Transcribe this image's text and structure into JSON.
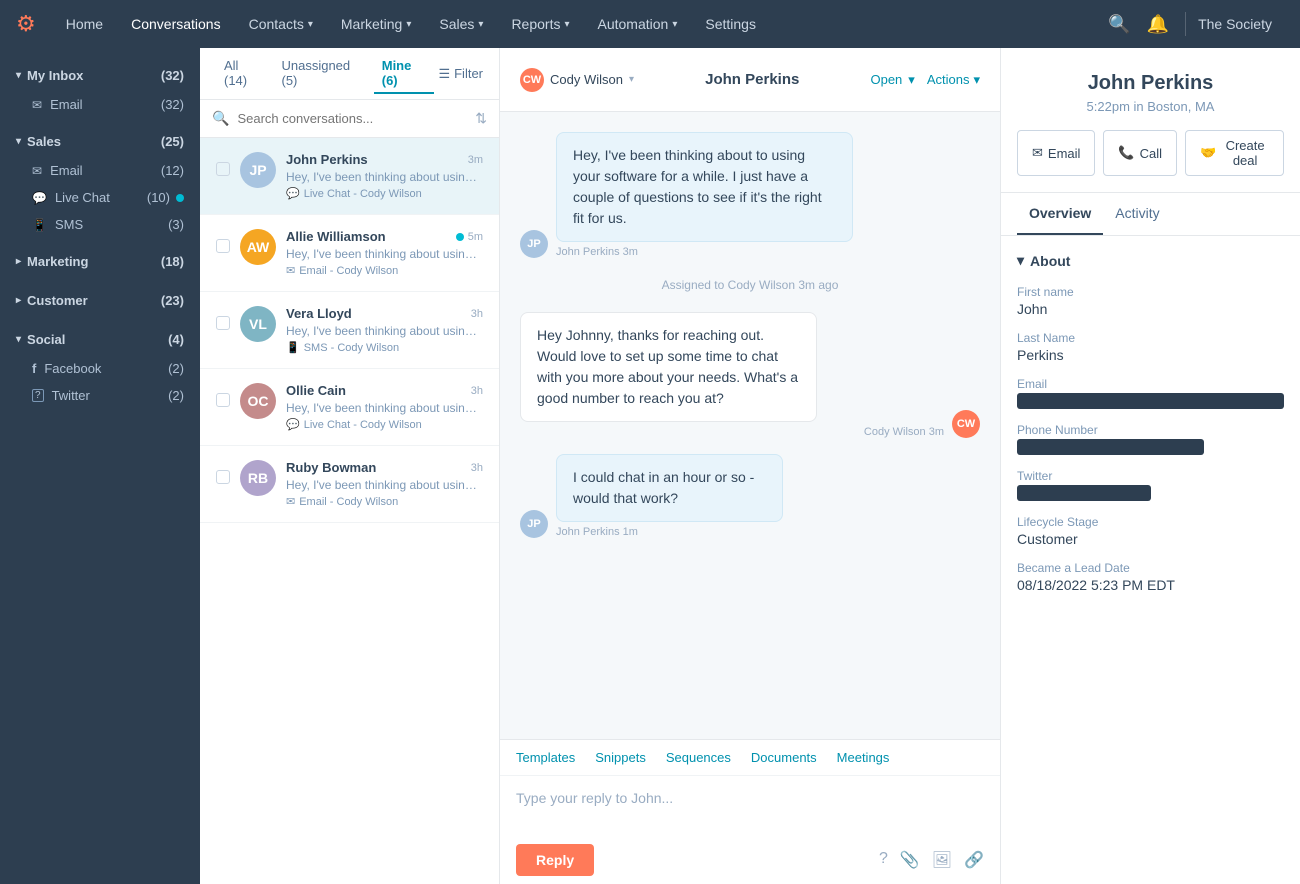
{
  "nav": {
    "logo": "🟠",
    "items": [
      {
        "label": "Home",
        "active": false
      },
      {
        "label": "Conversations",
        "active": true
      },
      {
        "label": "Contacts",
        "caret": true
      },
      {
        "label": "Marketing",
        "caret": true
      },
      {
        "label": "Sales",
        "caret": true
      },
      {
        "label": "Reports",
        "caret": true
      },
      {
        "label": "Automation",
        "caret": true
      },
      {
        "label": "Settings"
      }
    ],
    "org": "The Society"
  },
  "sidebar": {
    "sections": [
      {
        "label": "My Inbox",
        "count": "32",
        "expanded": true,
        "items": [
          {
            "icon": "✉",
            "label": "Email",
            "count": "32"
          }
        ]
      },
      {
        "label": "Sales",
        "count": "25",
        "expanded": true,
        "items": [
          {
            "icon": "✉",
            "label": "Email",
            "count": "12"
          },
          {
            "icon": "💬",
            "label": "Live Chat",
            "count": "10",
            "dot": true
          },
          {
            "icon": "📱",
            "label": "SMS",
            "count": "3"
          }
        ]
      },
      {
        "label": "Marketing",
        "count": "18",
        "expanded": false,
        "items": []
      },
      {
        "label": "Customer",
        "count": "23",
        "expanded": false,
        "items": []
      },
      {
        "label": "Social",
        "count": "4",
        "expanded": true,
        "items": [
          {
            "icon": "f",
            "label": "Facebook",
            "count": "2"
          },
          {
            "icon": "?",
            "label": "Twitter",
            "count": "2"
          }
        ]
      }
    ]
  },
  "tabs": {
    "all": {
      "label": "All",
      "count": "14"
    },
    "unassigned": {
      "label": "Unassigned",
      "count": "5"
    },
    "mine": {
      "label": "Mine",
      "count": "6"
    },
    "filter": "Filter"
  },
  "search": {
    "placeholder": "Search conversations..."
  },
  "conversations": [
    {
      "name": "John Perkins",
      "time": "3m",
      "preview": "Hey, I've been thinking about using your software for a while. I just ha...",
      "channel": "Live Chat - Cody Wilson",
      "channel_icon": "chat",
      "avatar_color": "#a8c4e0",
      "initials": "JP",
      "active": true
    },
    {
      "name": "Allie Williamson",
      "time": "5m",
      "preview": "Hey, I've been thinking about using your software for a while. I just ha...",
      "channel": "Email - Cody Wilson",
      "channel_icon": "email",
      "avatar_color": "#f5a623",
      "initials": "AW",
      "active": false,
      "online": true
    },
    {
      "name": "Vera Lloyd",
      "time": "3h",
      "preview": "Hey, I've been thinking about using your software for a while. I just ha...",
      "channel": "SMS - Cody Wilson",
      "channel_icon": "sms",
      "avatar_color": "#7fb5c4",
      "initials": "VL",
      "active": false
    },
    {
      "name": "Ollie Cain",
      "time": "3h",
      "preview": "Hey, I've been thinking about using your software for a while. I just ha...",
      "channel": "Live Chat - Cody Wilson",
      "channel_icon": "chat",
      "avatar_color": "#c48b8b",
      "initials": "OC",
      "active": false
    },
    {
      "name": "Ruby Bowman",
      "time": "3h",
      "preview": "Hey, I've been thinking about using your software for a while. I just ha...",
      "channel": "Email - Cody Wilson",
      "channel_icon": "email",
      "avatar_color": "#b0a4cc",
      "initials": "RB",
      "active": false
    }
  ],
  "chat": {
    "assigned_to": "Cody Wilson",
    "contact": "John Perkins",
    "status": "Open",
    "actions": "Actions",
    "messages": [
      {
        "direction": "inbound",
        "text": "Hey, I've been thinking about to using your software for a while. I just have a couple of questions to see if it's the right fit for us.",
        "sender": "John Perkins",
        "time": "3m",
        "avatar_color": "#a8c4e0",
        "initials": "JP"
      },
      {
        "direction": "system",
        "text": "Assigned to Cody Wilson 3m ago"
      },
      {
        "direction": "outbound",
        "text": "Hey Johnny, thanks for reaching out. Would love to set up some time to chat with you more about your needs. What's a good number to reach you at?",
        "sender": "Cody Wilson",
        "time": "3m",
        "avatar_color": "#ff7a59",
        "initials": "CW"
      },
      {
        "direction": "inbound",
        "text": "I could chat in an hour or so - would that work?",
        "sender": "John Perkins",
        "time": "1m",
        "avatar_color": "#a8c4e0",
        "initials": "JP"
      }
    ],
    "reply_placeholder": "Type your reply to John...",
    "reply_btn": "Reply",
    "toolbar_tabs": [
      {
        "label": "Templates"
      },
      {
        "label": "Snippets"
      },
      {
        "label": "Sequences"
      },
      {
        "label": "Documents"
      },
      {
        "label": "Meetings"
      }
    ]
  },
  "contact": {
    "name": "John Perkins",
    "time": "5:22pm in Boston, MA",
    "actions": [
      {
        "label": "Email",
        "icon": "✉"
      },
      {
        "label": "Call",
        "icon": "📞"
      },
      {
        "label": "Create deal",
        "icon": "🤝"
      }
    ],
    "tabs": [
      "Overview",
      "Activity"
    ],
    "about": {
      "header": "About",
      "fields": [
        {
          "label": "First name",
          "value": "John",
          "redacted": false
        },
        {
          "label": "Last Name",
          "value": "Perkins",
          "redacted": false
        },
        {
          "label": "Email",
          "value": "",
          "redacted": true
        },
        {
          "label": "Phone Number",
          "value": "",
          "redacted": true,
          "size": "sm"
        },
        {
          "label": "Twitter",
          "value": "",
          "redacted": true,
          "size": "xs"
        },
        {
          "label": "Lifecycle Stage",
          "value": "Customer",
          "redacted": false
        },
        {
          "label": "Became a Lead Date",
          "value": "08/18/2022 5:23 PM EDT",
          "redacted": false
        }
      ]
    }
  }
}
